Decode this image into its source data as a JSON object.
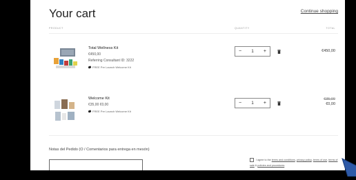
{
  "cart": {
    "title": "Your cart",
    "continue_link": "Continue shopping",
    "headers": {
      "product": "PRODUCT",
      "quantity": "QUANTITY",
      "total": "TOTAL"
    }
  },
  "items": [
    {
      "name": "Total Wellness Kit",
      "price": "€450,00",
      "consultant": "Referring Consultant ID: 3222",
      "promo": "FREE Pre Launch Welcome Kit",
      "quantity": "1",
      "total": "€450,00",
      "total_original": ""
    },
    {
      "name": "Welcome Kit",
      "price": "€35,00 €0,00",
      "consultant": "",
      "promo": "FREE Pre Launch Welcome Kit",
      "quantity": "1",
      "total": "€0,00",
      "total_original": "€35,00"
    }
  ],
  "notes": {
    "label": "Notas del Pedido (O / Comentarios para entrega en mesón)"
  },
  "terms": {
    "prefix": "I agree to the",
    "link1": "terms and conditions",
    "link2": "privacy policy",
    "link3": "terms of use",
    "link4": "terms of sale",
    "link5": "policies and procedures",
    "sep1": ",",
    "sep2": ",",
    "sep3": ",",
    "sep4": " & ",
    "suffix": "."
  },
  "icons": {
    "qty_minus": "−",
    "qty_plus": "+",
    "trash": "trash-icon",
    "tag": "tag-icon"
  },
  "colors": {
    "page_bg": "#000000",
    "cart_bg": "#ffffff",
    "cursor": "#2e5aa8"
  }
}
